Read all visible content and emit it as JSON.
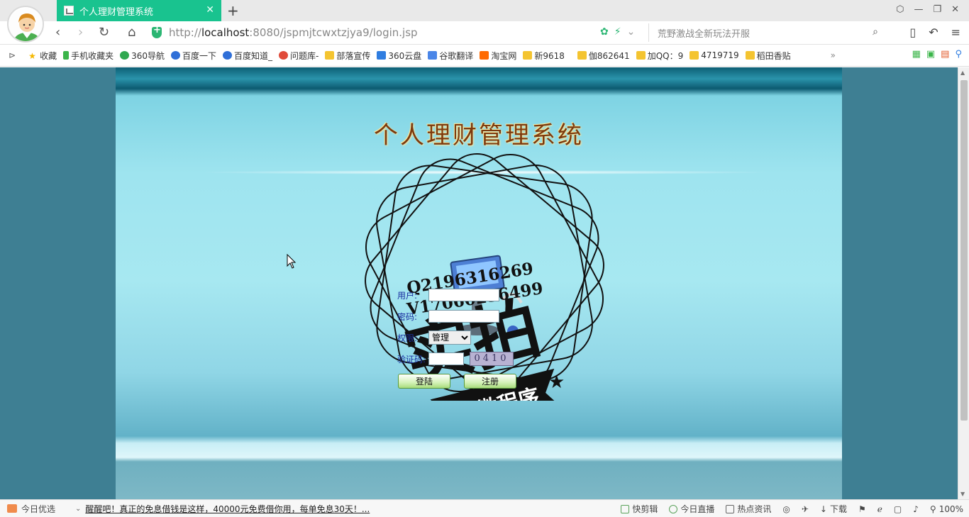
{
  "tab": {
    "title": "个人理财管理系统"
  },
  "address": {
    "scheme": "http://",
    "host": "localhost",
    "rest": ":8080/jspmjtcwxtzjya9/login.jsp"
  },
  "search": {
    "placeholder": "荒野激战全新玩法开服"
  },
  "bookmarks": [
    {
      "label": "收藏",
      "icon": "star-icon"
    },
    {
      "label": "手机收藏夹",
      "icon": "phone-icon"
    },
    {
      "label": "360导航",
      "icon": "globe-icon"
    },
    {
      "label": "百度一下",
      "icon": "paw-icon"
    },
    {
      "label": "百度知道_",
      "icon": "paw-icon"
    },
    {
      "label": "问题库-",
      "icon": "s-icon"
    },
    {
      "label": "部落宣传",
      "icon": "folder-icon"
    },
    {
      "label": "360云盘",
      "icon": "cloud-icon"
    },
    {
      "label": "谷歌翻译",
      "icon": "translate-icon"
    },
    {
      "label": "淘宝网",
      "icon": "taobao-icon"
    },
    {
      "label": "新9618",
      "icon": "folder-icon"
    },
    {
      "label": "伽862641",
      "icon": "folder-icon"
    },
    {
      "label": "加QQ：9",
      "icon": "folder-icon"
    },
    {
      "label": "4719719",
      "icon": "folder-icon"
    },
    {
      "label": "稻田香贴",
      "icon": "folder-icon"
    }
  ],
  "page": {
    "title": "个人理财管理系统",
    "form": {
      "user_label": "用户:",
      "pass_label": "密码:",
      "role_label": "权限:",
      "role_value": "管理",
      "captcha_label": "验证码:",
      "captcha_value": "0410",
      "login_button": "登陆",
      "register_button": "注册"
    }
  },
  "watermark": {
    "line1": "Q2196316269",
    "line2": "V17060256499",
    "big_text": "实拍",
    "ribbon_text": "全微程序"
  },
  "status": {
    "left_label": "今日优选",
    "news": "醒醒吧！真正的免息借钱是这样，40000元免费借你用，每单免息30天！...",
    "right": [
      {
        "label": "快剪辑"
      },
      {
        "label": "今日直播"
      },
      {
        "label": "热点资讯"
      },
      {
        "label": "下载"
      },
      {
        "label": "100%"
      }
    ]
  }
}
